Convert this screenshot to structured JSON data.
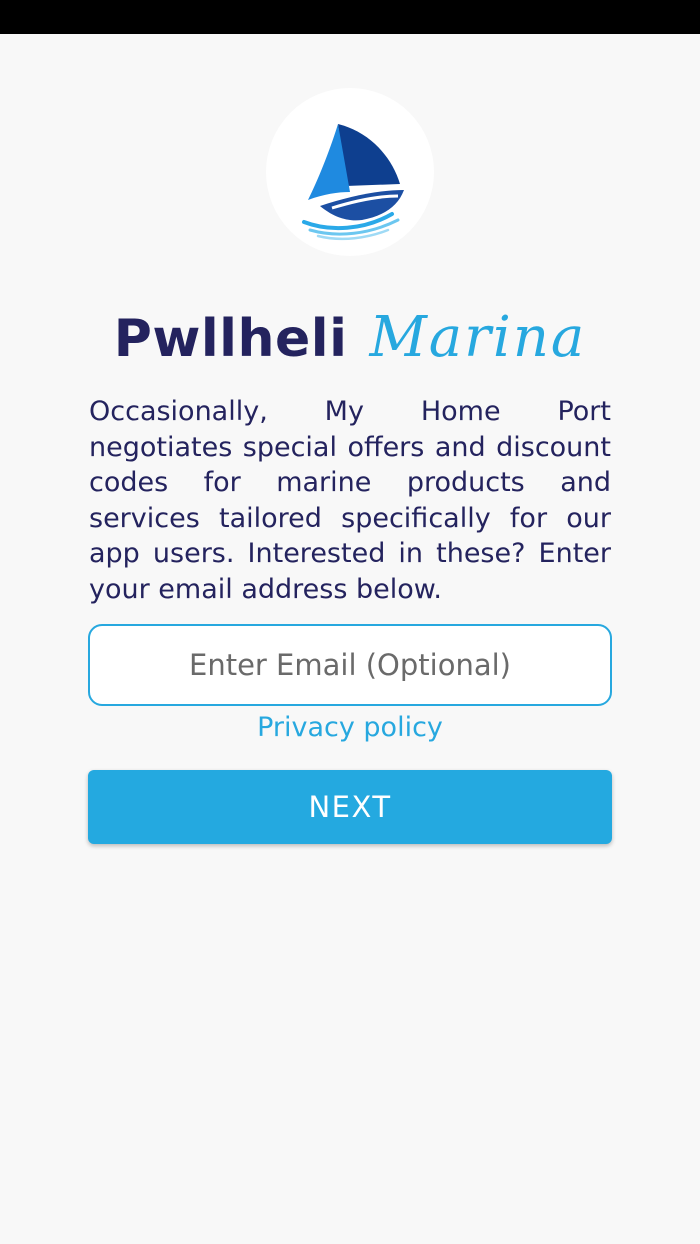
{
  "branding": {
    "name_main": "Pwllheli",
    "name_script": "Marina",
    "logo_icon": "sailboat-logo-icon",
    "colors": {
      "navy": "#24235e",
      "accent": "#27a8df",
      "button": "#24a9e0"
    }
  },
  "content": {
    "description": "Occasionally, My Home Port negotiates special offers and discount codes for marine products and services tailored specifically for our app users. Interested in these? Enter your email address below."
  },
  "form": {
    "email_value": "",
    "email_placeholder": "Enter Email (Optional)",
    "privacy_label": "Privacy policy",
    "next_label": "NEXT"
  }
}
